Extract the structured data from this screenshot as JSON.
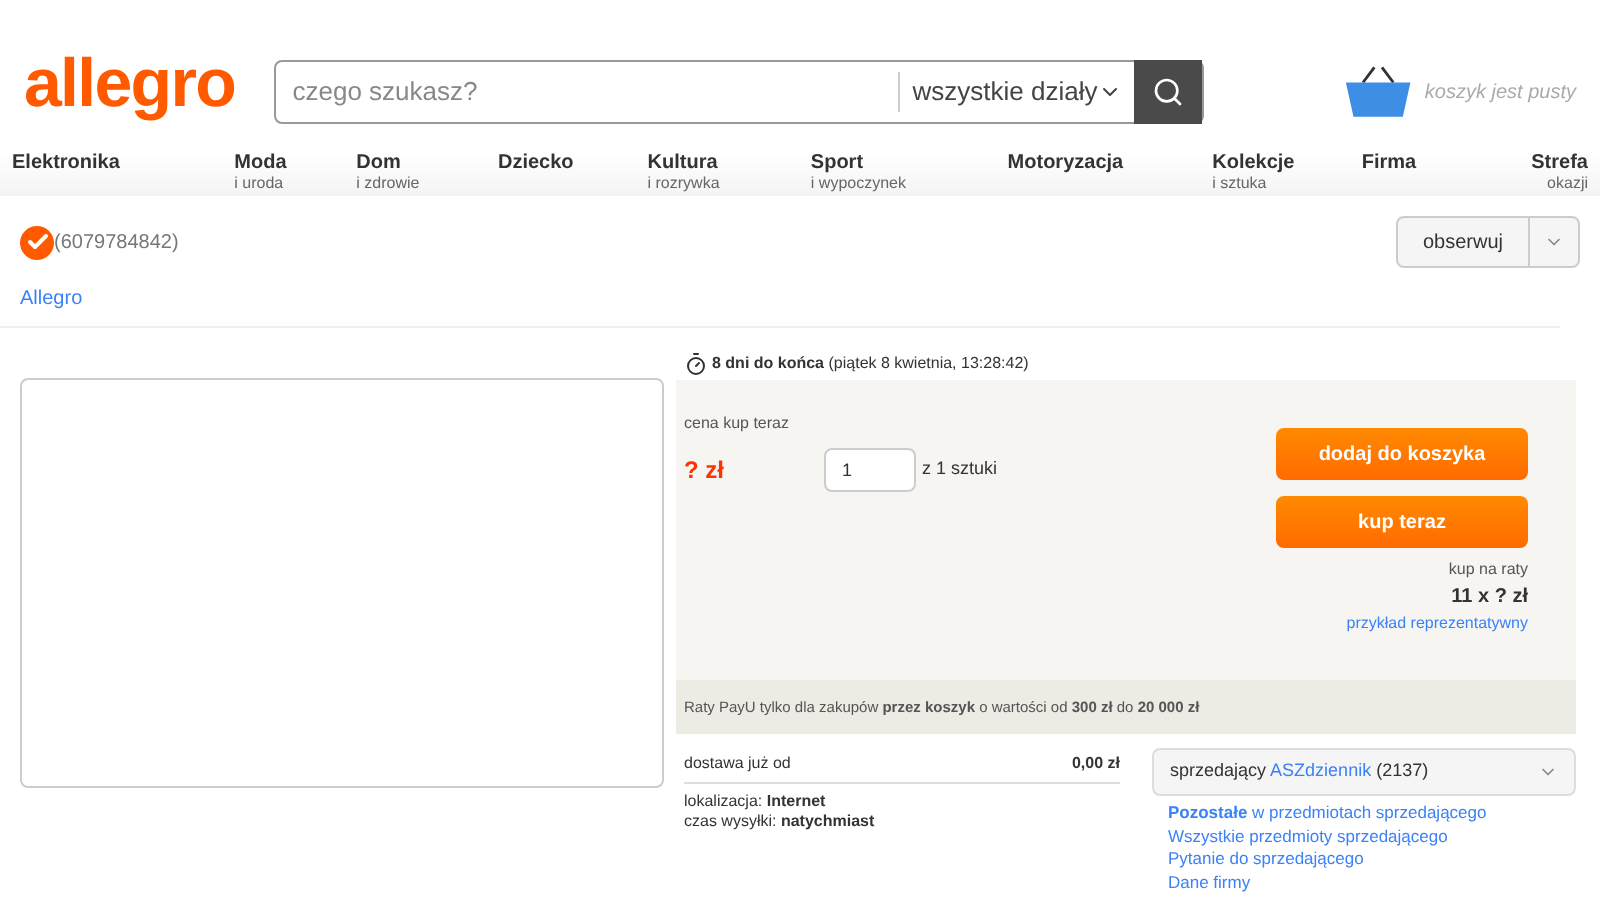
{
  "header": {
    "logo": "allegro",
    "search": {
      "placeholder": "czego szukasz?"
    },
    "category": "wszystkie działy",
    "cart": "koszyk jest pusty"
  },
  "nav": [
    {
      "label": "Elektronika"
    },
    {
      "label": "Moda",
      "sub": "i uroda"
    },
    {
      "label": "Dom",
      "sub": "i zdrowie"
    },
    {
      "label": "Dziecko"
    },
    {
      "label": "Kultura",
      "sub": "i rozrywka"
    },
    {
      "label": "Sport",
      "sub": "i wypoczynek"
    },
    {
      "label": "Motoryzacja"
    },
    {
      "label": "Kolekcje",
      "sub": "i sztuka"
    },
    {
      "label": "Firma"
    },
    {
      "label": "Strefa",
      "sub": "okazji"
    }
  ],
  "item": {
    "id": "(6079784842)",
    "breadcrumb": "Allegro",
    "watch": "obserwuj"
  },
  "offer": {
    "ends": "8 dni do końca",
    "ends_detail": "(piątek 8 kwietnia, 13:28:42)",
    "price_label": "cena kup teraz",
    "price": "? zł",
    "quantity": "1",
    "of": "z 1 sztuki",
    "add_to_cart": "dodaj do koszyka",
    "buy_now": "kup teraz",
    "installments_label": "kup na raty",
    "installments": "11 x ? zł",
    "example": "przykład reprezentatywny",
    "payu": "Raty PayU tylko dla zakupów **przez koszyk** o wartości od **300 zł** do **20 000 zł**"
  },
  "delivery": {
    "label": "dostawa już od",
    "price": "0,00 zł",
    "location": "lokalizacja: **Internet**",
    "shipping": "czas wysyłki: **natychmiast**"
  },
  "seller": {
    "label": "sprzedający",
    "name": "ASZdziennik",
    "count": "(2137)",
    "links": [
      "**Pozostałe** w przedmiotach sprzedającego",
      "Wszystkie przedmioty sprzedającego",
      "Pytanie do sprzedającego",
      "Dane firmy"
    ]
  }
}
